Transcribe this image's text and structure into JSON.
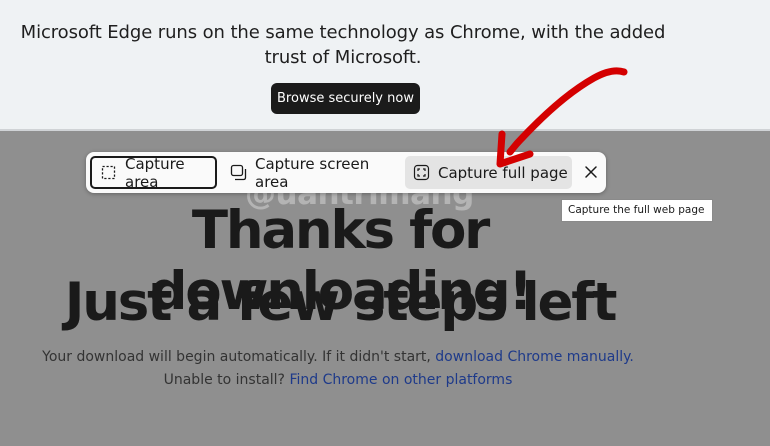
{
  "banner": {
    "text_line1": "Microsoft Edge runs on the same technology as Chrome, with the added",
    "text_line2": "trust of Microsoft.",
    "button_label": "Browse securely now"
  },
  "toolbar": {
    "capture_area_label": "Capture area",
    "capture_screen_area_label": "Capture screen area",
    "capture_full_page_label": "Capture full page",
    "tooltip": "Capture the full web page"
  },
  "page": {
    "headline_line1": "Thanks for downloading!",
    "headline_line2": "Just a few steps left",
    "sub1_text": "Your download will begin automatically. If it didn't start, ",
    "sub1_link": "download Chrome manually.",
    "sub2_text": "Unable to install? ",
    "sub2_link": "Find Chrome on other platforms"
  },
  "watermark": "@uantrimang",
  "colors": {
    "arrow": "#d40000",
    "link": "#1e3a8a",
    "overlay": "#8f8f8f"
  }
}
